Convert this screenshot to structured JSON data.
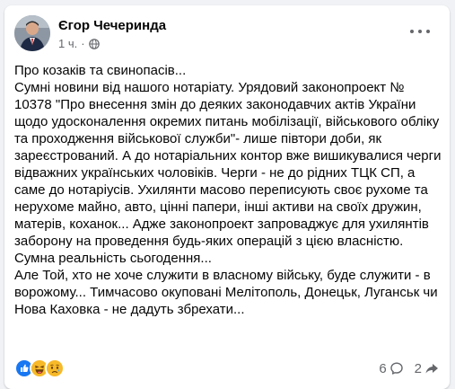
{
  "post": {
    "author": "Єгор Чечеринда",
    "time": "1 ч.",
    "privacy_icon": "globe-icon",
    "paragraphs": [
      "Про козаків та свинопасів...",
      "Сумні новини від нашого нотаріату. Урядовий законопроект  № 10378 \"Про внесення змін до деяких законодавчих актів України щодо удосконалення окремих питань мобілізації, військового обліку та проходження військової служби\"- лише півтори доби, як зареєстрований. А до нотаріальних контор вже вишикувалися черги відважних українських чоловіків. Черги - не до рідних ТЦК СП, а саме до нотаріусів. Ухилянти масово переписують своє рухоме та нерухоме майно, авто, цінні папери, інші активи  на своїх дружин, матерів, коханок... Адже законопроект запроваджує для ухилянтів заборону на проведення будь-яких операцій з цією власністю.",
      "Сумна реальність сьогодення...",
      "Але Той, хто не хоче служити в власному війську, буде служити - в ворожому... Тимчасово окуповані Мелітополь, Донецьк, Луганськ чи Нова Каховка - не дадуть збрехати..."
    ]
  },
  "footer": {
    "reactions": [
      "like",
      "haha",
      "sad"
    ],
    "comment_count": "6",
    "share_count": "2"
  },
  "colors": {
    "like": "#1877f2",
    "reaction_yellow": "#f7b928",
    "secondary_text": "#65676b"
  }
}
